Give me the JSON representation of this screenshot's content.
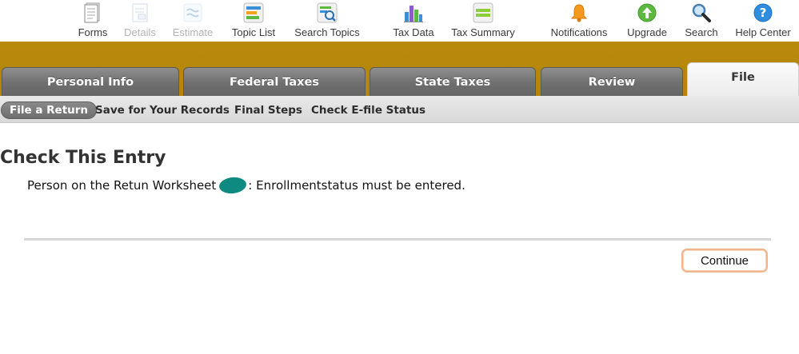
{
  "toolbar": {
    "items": [
      {
        "label": "Forms",
        "icon": "forms-icon"
      },
      {
        "label": "Details",
        "icon": "details-icon"
      },
      {
        "label": "Estimate",
        "icon": "estimate-icon"
      },
      {
        "label": "Topic List",
        "icon": "topic-list-icon"
      },
      {
        "label": "Search Topics",
        "icon": "search-topics-icon"
      },
      {
        "label": "Tax Data",
        "icon": "bar-chart-icon"
      },
      {
        "label": "Tax Summary",
        "icon": "tax-summary-icon"
      },
      {
        "label": "Notifications",
        "icon": "bell-icon"
      },
      {
        "label": "Upgrade",
        "icon": "upgrade-arrow-icon"
      },
      {
        "label": "Search",
        "icon": "magnifier-icon"
      },
      {
        "label": "Help Center",
        "icon": "help-icon"
      }
    ]
  },
  "tabs": [
    {
      "label": "Personal Info"
    },
    {
      "label": "Federal Taxes"
    },
    {
      "label": "State Taxes"
    },
    {
      "label": "Review"
    },
    {
      "label": "File",
      "active": true
    }
  ],
  "subnav": [
    {
      "label": "File a Return",
      "active": true
    },
    {
      "label": "Save for Your Records"
    },
    {
      "label": "Final Steps"
    },
    {
      "label": "Check E-file Status"
    }
  ],
  "main": {
    "title": "Check This Entry",
    "message_prefix": "Person on the Retun Worksheet",
    "message_suffix": ": Enrollmentstatus must be entered.",
    "continue_label": "Continue"
  },
  "colors": {
    "gold_band": "#b88a0c",
    "tab_gray": "#6f6f6f",
    "redaction": "#0f8a80",
    "continue_border": "#f2b48a"
  }
}
